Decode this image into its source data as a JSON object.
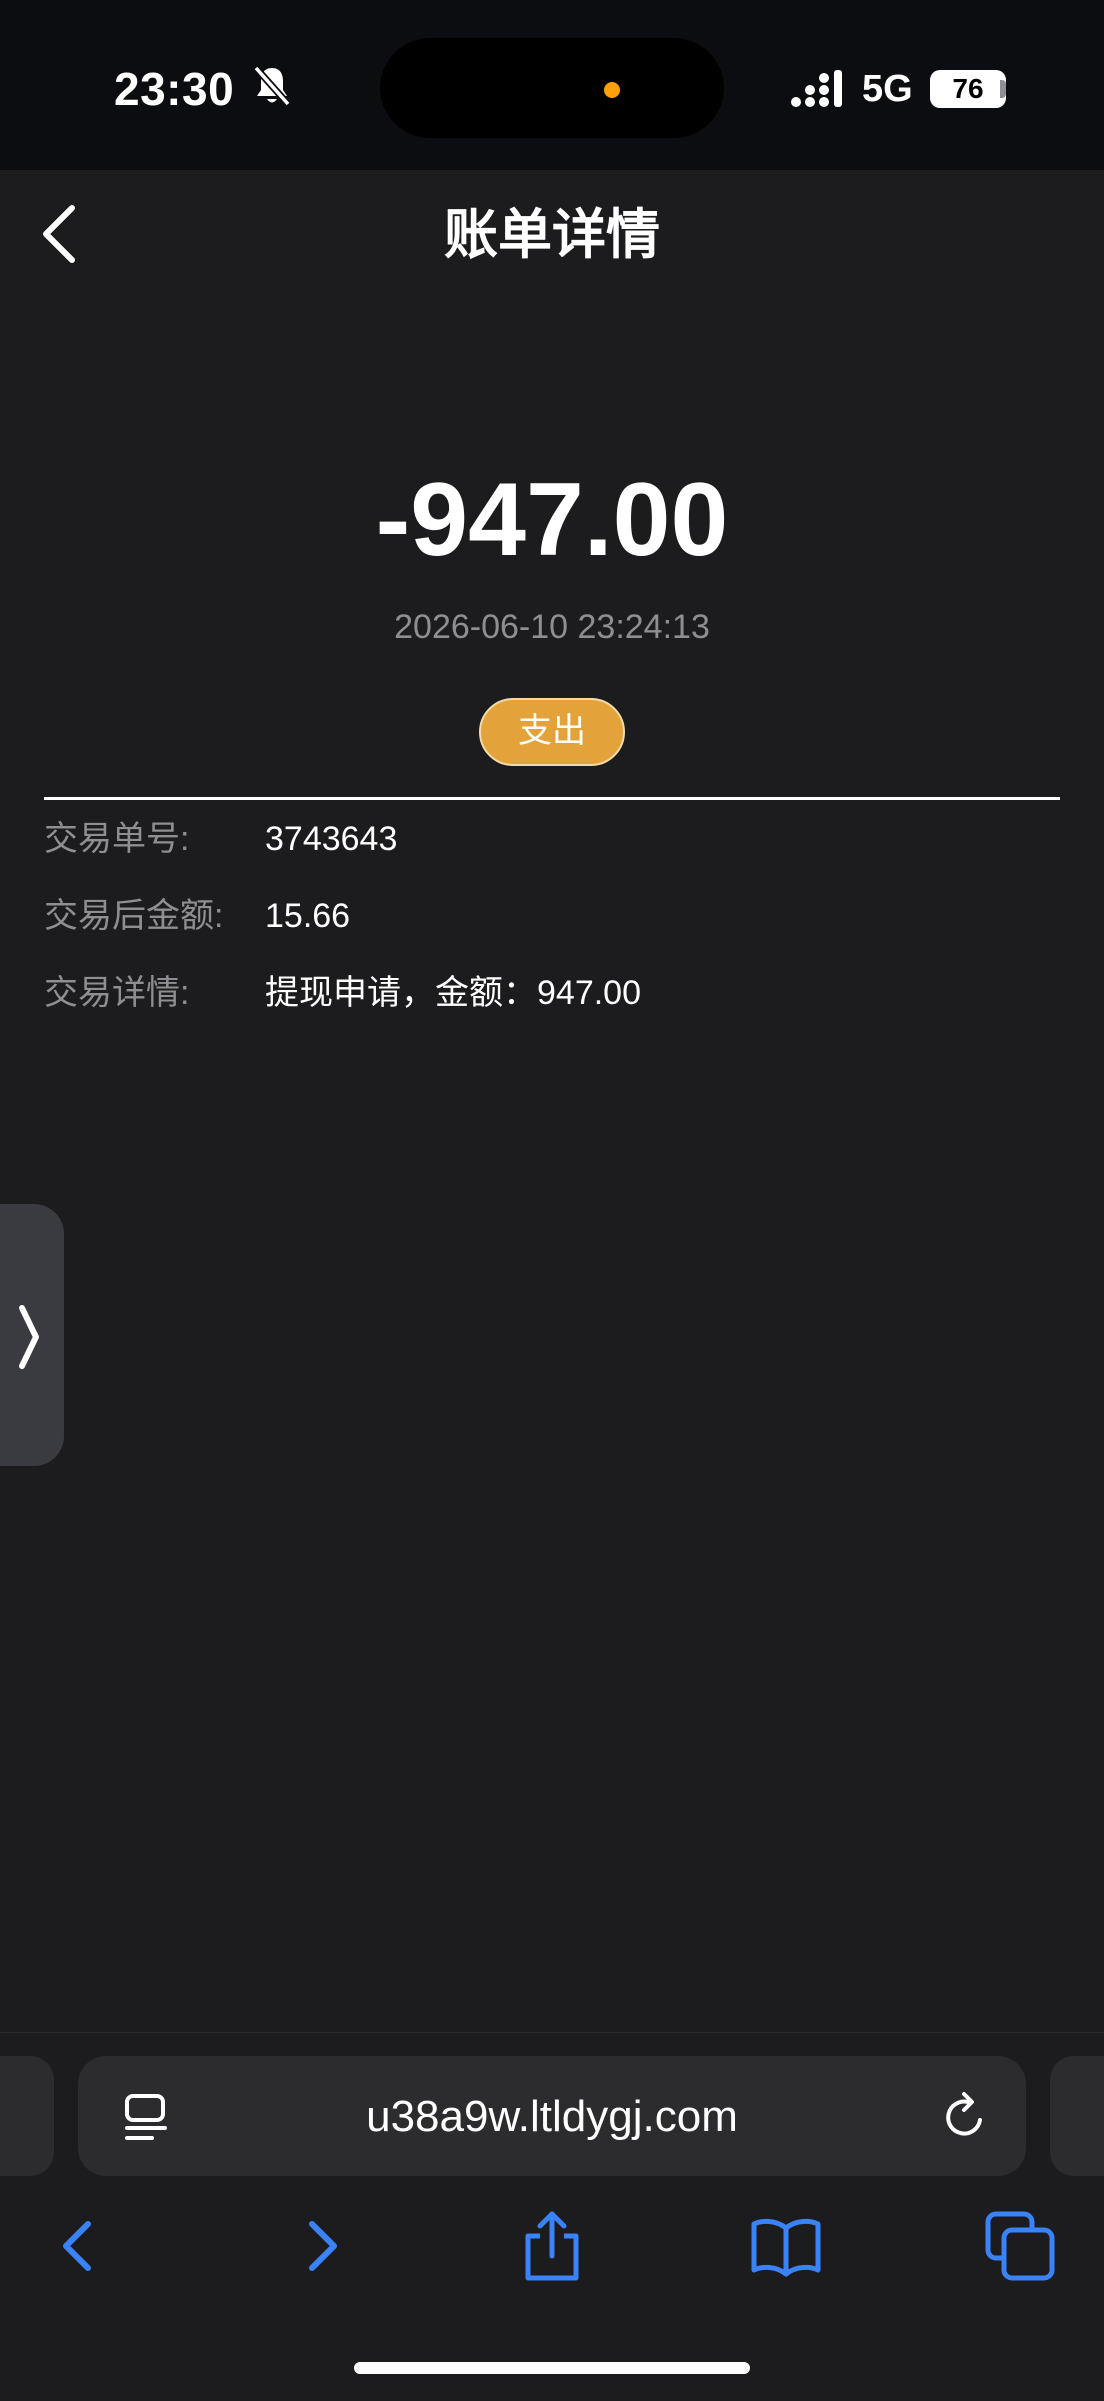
{
  "status_bar": {
    "time": "23:30",
    "network": "5G",
    "battery": "76",
    "icons": [
      "bell-slash-icon",
      "signal-icon"
    ]
  },
  "nav": {
    "title": "账单详情",
    "back_icon": "chevron-left-icon"
  },
  "transaction": {
    "amount": "-947.00",
    "datetime": "2026-06-10 23:24:13",
    "type_badge": "支出",
    "badge_color": "#e3a33a",
    "details": [
      {
        "label": "交易单号:",
        "value": "3743643"
      },
      {
        "label": "交易后金额:",
        "value": "15.66"
      },
      {
        "label": "交易详情:",
        "value": "提现申请，金额：947.00"
      }
    ]
  },
  "browser": {
    "url": "u38a9w.ltldygj.com",
    "accent": "#3a82f7",
    "toolbar": [
      "back-icon",
      "forward-icon",
      "share-icon",
      "bookmarks-icon",
      "tabs-icon"
    ]
  }
}
